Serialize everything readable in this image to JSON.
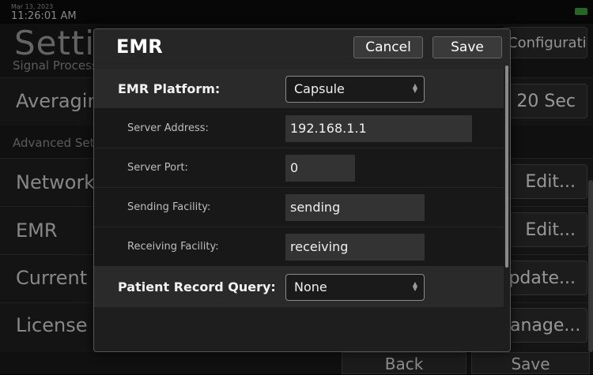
{
  "status": {
    "date": "Mar 13, 2023",
    "time": "11:26:01 AM"
  },
  "background": {
    "title": "Settings",
    "configuration_button": "Configuration",
    "signal_processing_label": "Signal Processing",
    "averaging_label": "Averaging",
    "averaging_value": "20 Sec",
    "advanced_label": "Advanced Settings",
    "rows": [
      {
        "label": "Network",
        "button": "Edit..."
      },
      {
        "label": "EMR",
        "button": "Edit..."
      },
      {
        "label": "Current",
        "button": "Update..."
      },
      {
        "label": "License",
        "button": "Manage..."
      }
    ],
    "back_button": "Back",
    "save_button": "Save"
  },
  "dialog": {
    "title": "EMR",
    "cancel_label": "Cancel",
    "save_label": "Save",
    "fields": {
      "platform_label": "EMR Platform:",
      "platform_value": "Capsule",
      "server_address_label": "Server Address:",
      "server_address_value": "192.168.1.1",
      "server_port_label": "Server Port:",
      "server_port_value": "0",
      "sending_facility_label": "Sending Facility:",
      "sending_facility_value": "sending",
      "receiving_facility_label": "Receiving Facility:",
      "receiving_facility_value": "receiving",
      "patient_query_label": "Patient Record Query:",
      "patient_query_value": "None"
    }
  }
}
